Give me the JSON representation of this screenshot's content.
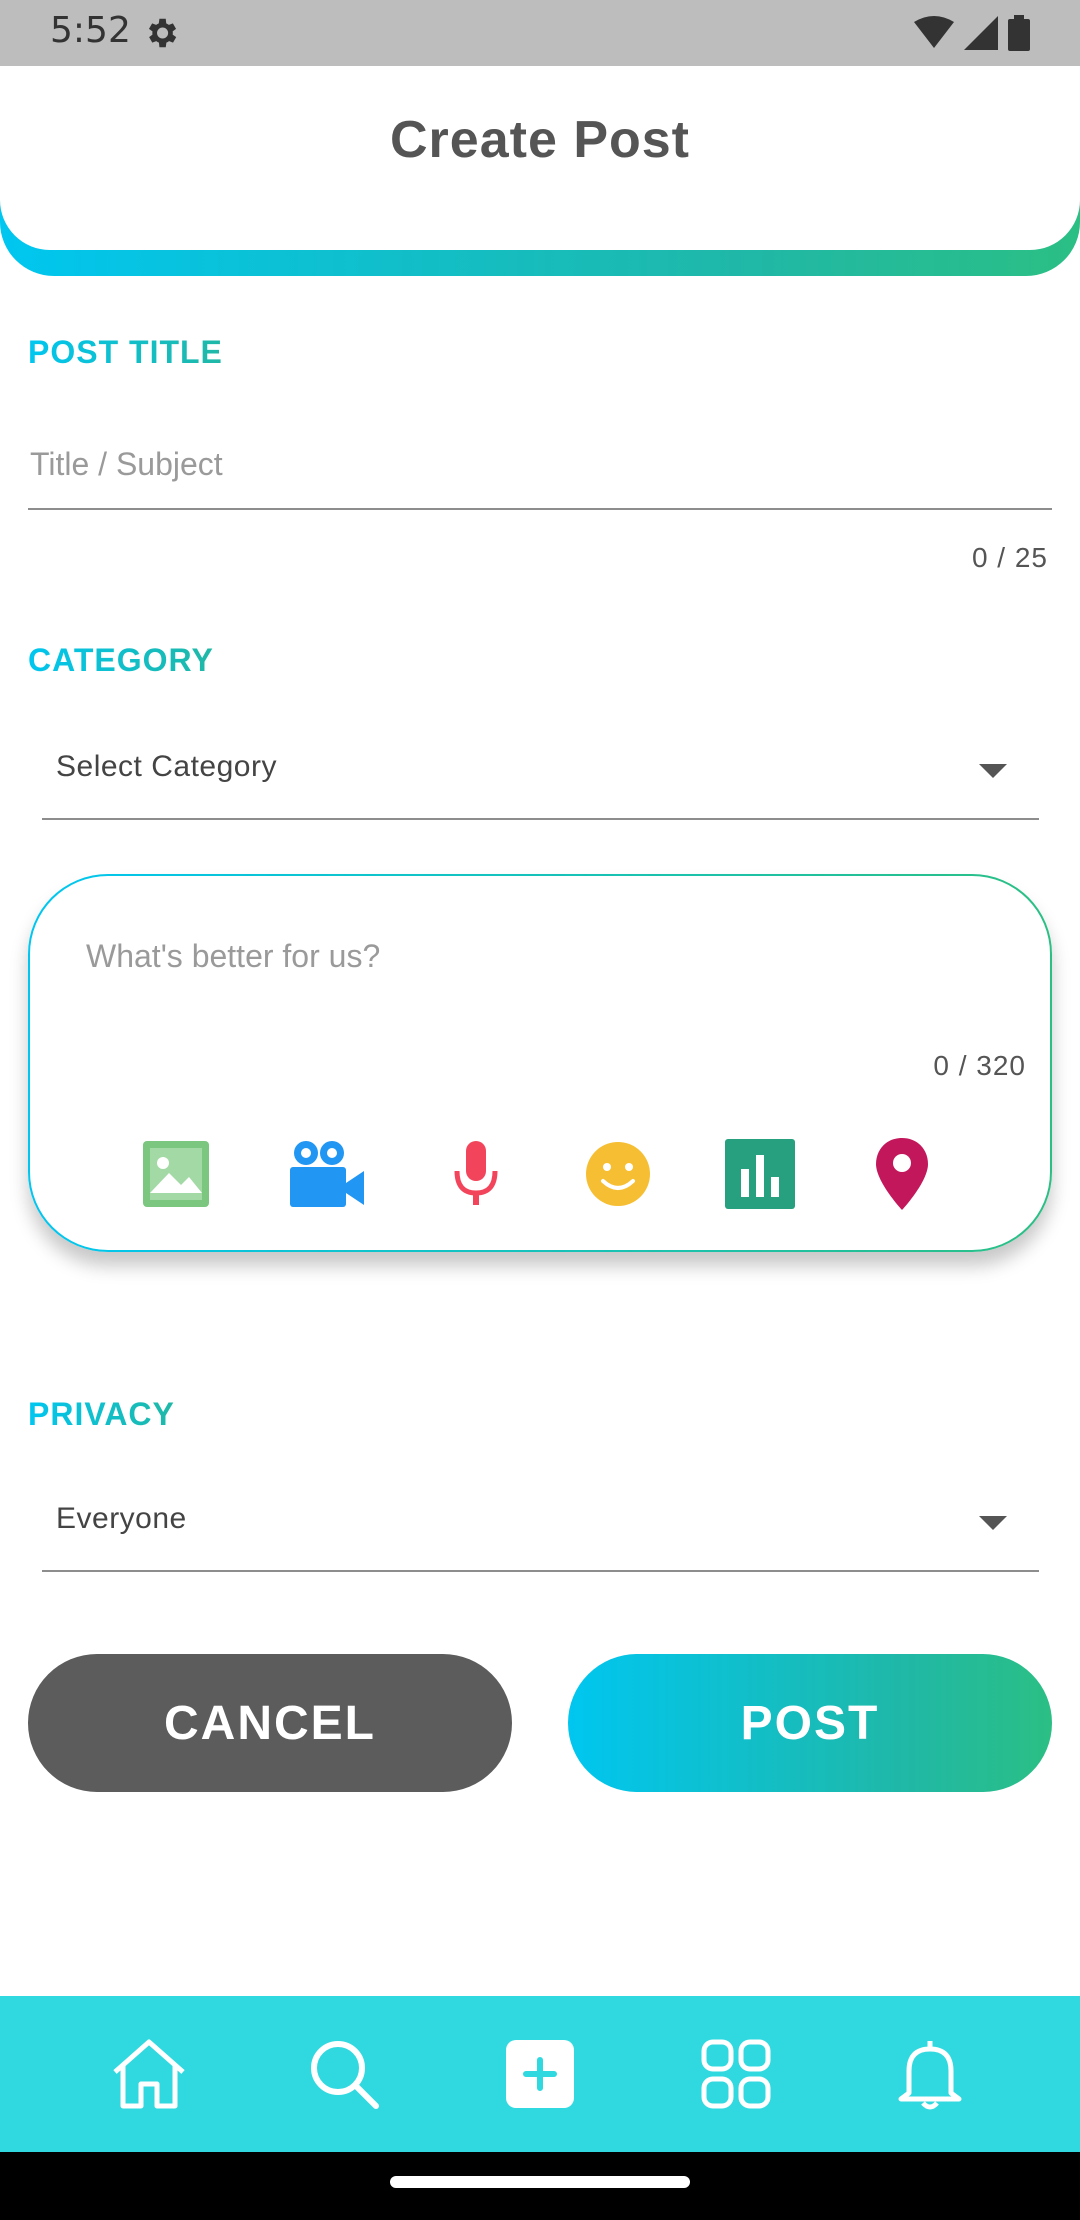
{
  "status_bar": {
    "time": "5:52"
  },
  "header": {
    "title": "Create Post"
  },
  "post_title": {
    "label": "POST TITLE",
    "placeholder": "Title / Subject",
    "counter": "0 / 25"
  },
  "category": {
    "label": "CATEGORY",
    "value": "Select Category"
  },
  "compose": {
    "placeholder": "What's better for us?",
    "counter": "0 / 320",
    "tools": [
      "image-icon",
      "video-camera-icon",
      "microphone-icon",
      "emoji-icon",
      "poll-chart-icon",
      "location-pin-icon"
    ]
  },
  "privacy": {
    "label": "PRIVACY",
    "value": "Everyone"
  },
  "buttons": {
    "cancel": "CANCEL",
    "post": "POST"
  },
  "bottom_nav": [
    "home-icon",
    "search-icon",
    "add-post-icon",
    "grid-icon",
    "bell-icon"
  ],
  "colors": {
    "accent_start": "#00c6f0",
    "accent_end": "#2bbf84",
    "nav_bg": "#30d9df",
    "cancel_bg": "#5c5c5c"
  }
}
